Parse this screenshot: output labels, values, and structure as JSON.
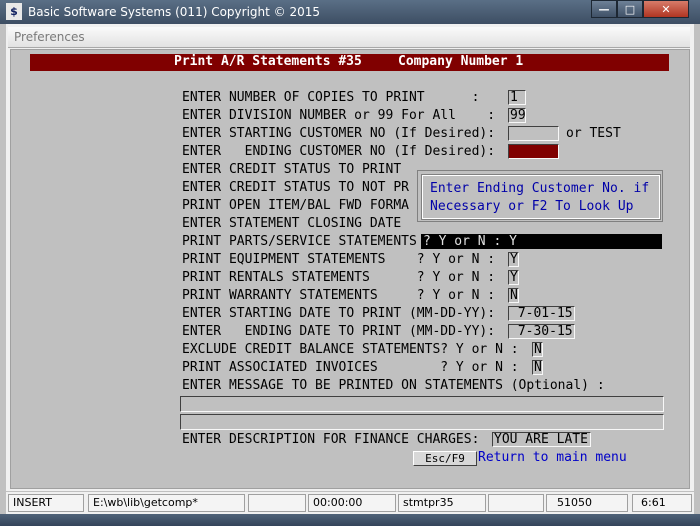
{
  "window": {
    "title": "Basic Software Systems (011) Copyright © 2015",
    "icon": "app-logo-icon",
    "controls": {
      "minimize": "—",
      "maximize": "□",
      "close": "✕"
    }
  },
  "menubar": {
    "preferences": "Preferences"
  },
  "header": {
    "title": "Print A/R Statements #35",
    "company": "Company Number 1"
  },
  "prompts": {
    "copies": "ENTER NUMBER OF COPIES TO PRINT      :",
    "division": "ENTER DIVISION NUMBER or 99 For All    :",
    "start_cust": "ENTER STARTING CUSTOMER NO (If Desired):",
    "or_test": "or TEST",
    "end_cust": "ENTER   ENDING CUSTOMER NO (If Desired):",
    "credit_print": "ENTER CREDIT STATUS TO PRINT",
    "credit_not": "ENTER CREDIT STATUS TO NOT PR",
    "open_item": "PRINT OPEN ITEM/BAL FWD FORMA",
    "closing_date": "ENTER STATEMENT CLOSING DATE",
    "parts": "PRINT PARTS/SERVICE STATEMENTS",
    "equipment": "PRINT EQUIPMENT STATEMENTS    ? Y or N :",
    "rentals": "PRINT RENTALS STATEMENTS      ? Y or N :",
    "warranty": "PRINT WARRANTY STATEMENTS     ? Y or N :",
    "start_date": "ENTER STARTING DATE TO PRINT (MM-DD-YY):",
    "end_date": "ENTER   ENDING DATE TO PRINT (MM-DD-YY):",
    "exclude_credit": "EXCLUDE CREDIT BALANCE STATEMENTS? Y or N :",
    "associated": "PRINT ASSOCIATED INVOICES        ? Y or N :",
    "message": "ENTER MESSAGE TO BE PRINTED ON STATEMENTS (Optional) :",
    "finance": "ENTER DESCRIPTION FOR FINANCE CHARGES:"
  },
  "values": {
    "copies": "1",
    "division": "99",
    "start_cust": "",
    "end_cust": "",
    "parts": "? Y or N : Y",
    "equipment": "Y",
    "rentals": "Y",
    "warranty": "N",
    "start_date": " 7-01-15",
    "end_date": " 7-30-15",
    "exclude_credit": "N",
    "associated": "N",
    "message_line1": "",
    "message_line2": "",
    "finance": "YOU ARE LATE"
  },
  "popup": {
    "line1": "Enter Ending Customer No. if",
    "line2": "Necessary or F2 To Look Up"
  },
  "actions": {
    "esc": "Esc/F9",
    "return": "Return to main menu"
  },
  "statusbar": {
    "mode": "INSERT",
    "path": "E:\\wb\\lib\\getcomp*",
    "blank1": "",
    "time": "00:00:00",
    "program": "stmtpr35",
    "blank2": "",
    "port": "51050",
    "version": "6:61"
  },
  "colors": {
    "screen": "#c0c0c0",
    "header": "#800000",
    "popup_text": "#0000a8",
    "link": "#0000c8"
  }
}
